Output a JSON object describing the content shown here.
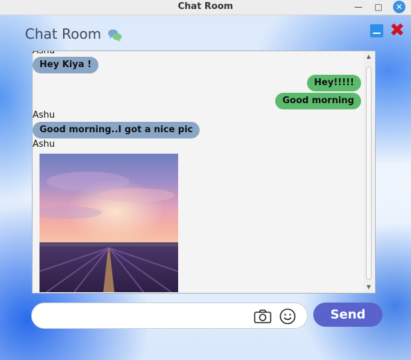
{
  "window": {
    "title": "Chat Room"
  },
  "header": {
    "title": "Chat Room",
    "icon": "chat-bubbles-icon"
  },
  "messages": [
    {
      "sender": "Ashu",
      "text": "Hey Kiya !",
      "direction": "incoming"
    },
    {
      "sender": "",
      "text": "Hey!!!!!",
      "direction": "outgoing"
    },
    {
      "sender": "",
      "text": "Good morning",
      "direction": "outgoing"
    },
    {
      "sender": "Ashu",
      "text": "Good morning..I got a nice pic",
      "direction": "incoming"
    },
    {
      "sender": "Ashu",
      "text": "",
      "direction": "incoming",
      "attachment": "landscape-photo"
    }
  ],
  "composer": {
    "value": "",
    "placeholder": ""
  },
  "send_button": {
    "label": "Send"
  },
  "colors": {
    "incoming_bubble": "#8aa6c6",
    "outgoing_bubble": "#5cba6c",
    "send_button": "#5a63cc",
    "close_icon": "#d0101e",
    "minimize_icon": "#2f8fe8"
  }
}
